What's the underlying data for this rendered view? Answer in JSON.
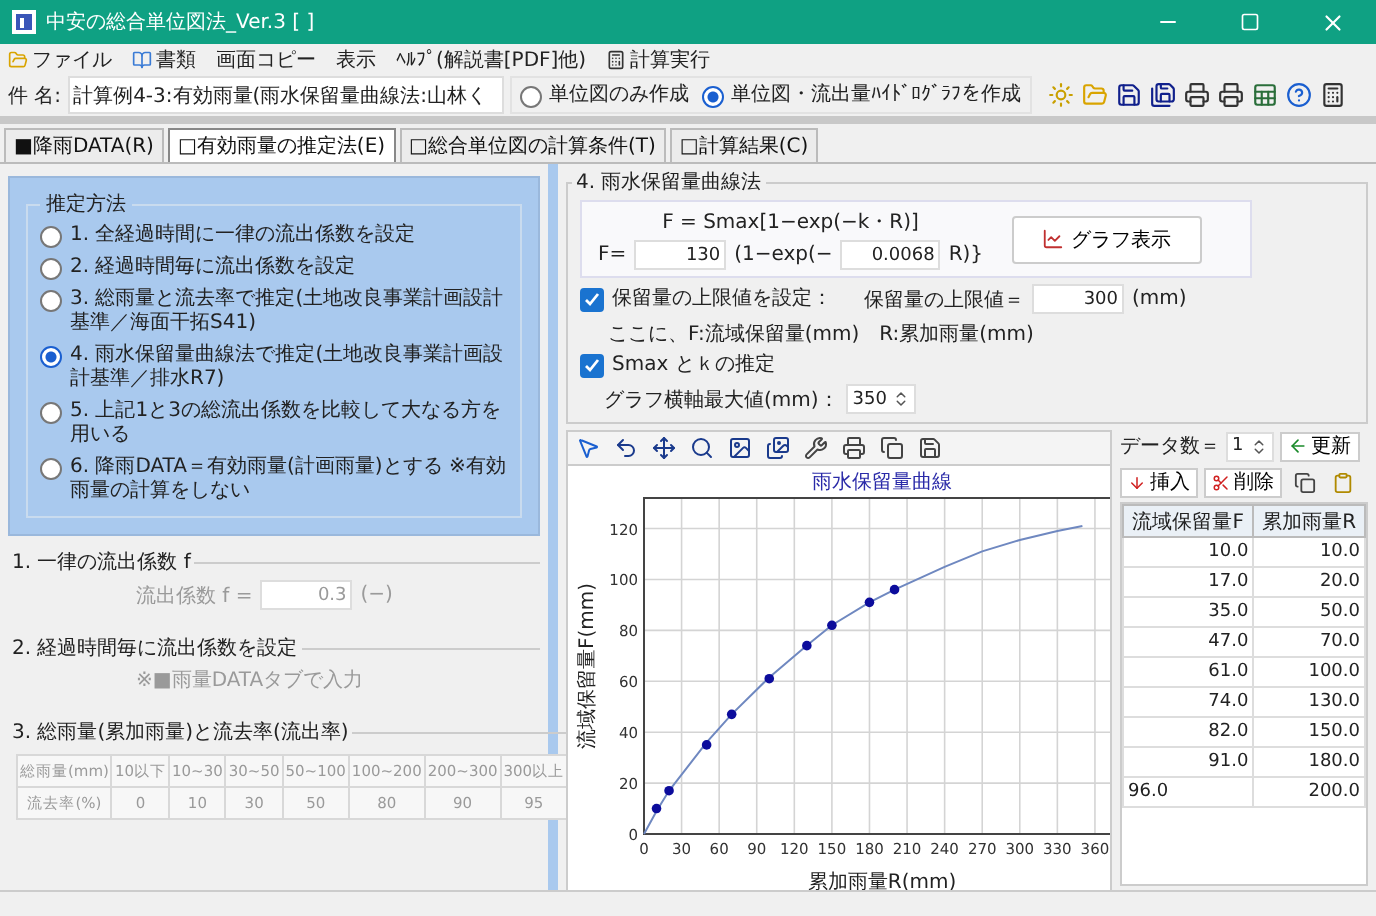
{
  "window": {
    "title": "中安の総合単位図法_Ver.3 [ ]"
  },
  "menu": [
    "ファイル",
    "書類",
    "画面コピー",
    "表示",
    "ﾍﾙﾌﾟ(解説書[PDF]他)",
    "計算実行"
  ],
  "subject": {
    "label": "件 名:",
    "value": "計算例4-3:有効雨量(雨水保留量曲線法:山林く"
  },
  "output_mode": [
    {
      "label": "単位図のみ作成",
      "selected": false
    },
    {
      "label": "単位図・流出量ﾊｲﾄﾞﾛｸﾞﾗﾌを作成",
      "selected": true
    }
  ],
  "tabs": [
    {
      "label": "■降雨DATA(R)",
      "selected": false
    },
    {
      "label": "□有効雨量の推定法(E)",
      "selected": true
    },
    {
      "label": "□総合単位図の計算条件(T)",
      "selected": false
    },
    {
      "label": "□計算結果(C)",
      "selected": false
    }
  ],
  "estimation": {
    "title": "推定方法",
    "options": [
      {
        "label": "1. 全経過時間に一律の流出係数を設定",
        "selected": false
      },
      {
        "label": "2. 経過時間毎に流出係数を設定",
        "selected": false
      },
      {
        "label": "3. 総雨量と流去率で推定(土地改良事業計画設計基準／海面干拓S41)",
        "selected": false
      },
      {
        "label": "4. 雨水保留量曲線法で推定(土地改良事業計画設計基準／排水R7)",
        "selected": true
      },
      {
        "label": "5. 上記1と3の総流出係数を比較して大なる方を用いる",
        "selected": false
      },
      {
        "label": "6. 降雨DATA＝有効雨量(計画雨量)とする ※有効雨量の計算をしない",
        "selected": false
      }
    ]
  },
  "constant_coefficient": {
    "title": "1. 一律の流出係数 f",
    "label": "流出係数 f =",
    "value": "0.3",
    "unit": "(−)",
    "disabled": true
  },
  "timestep_coefficient": {
    "title": "2. 経過時間毎に流出係数を設定",
    "note": "※■雨量DATAタブで入力",
    "disabled": true
  },
  "runoff_table": {
    "title": "3. 総雨量(累加雨量)と流去率(流出率)",
    "disabled": true,
    "rows": [
      [
        "総雨量(mm)",
        "10以下",
        "10~30",
        "30~50",
        "50~100",
        "100~200",
        "200~300",
        "300以上"
      ],
      [
        "流去率(%)",
        "0",
        "10",
        "30",
        "50",
        "80",
        "90",
        "95"
      ]
    ]
  },
  "retention_curve": {
    "title": "4. 雨水保留量曲線法",
    "formula": "F = Smax[1−exp(−k・R)]",
    "f_label": "F=",
    "smax": "130",
    "exp_label": "(1−exp(−",
    "k": "0.0068",
    "r_label": "R)}",
    "graph_button": "グラフ表示",
    "upper_limit": {
      "label": "保留量の上限値を設定：",
      "checked": true,
      "value_label": "保留量の上限値＝",
      "value": "300",
      "unit": "(mm)"
    },
    "legend": "ここに、F:流域保留量(mm)　R:累加雨量(mm)",
    "estimate": {
      "label": "Smax とｋの推定",
      "checked": true
    },
    "axis_max": {
      "label": "グラフ横軸最大値(mm)：",
      "value": "350"
    },
    "chart_data": {
      "type": "line",
      "title": "雨水保留量曲線",
      "xlabel": "累加雨量R(mm)",
      "ylabel": "流域保留量F(mm)",
      "x": [
        0,
        10,
        20,
        50,
        70,
        100,
        130,
        150,
        180,
        200,
        240,
        270,
        300,
        330,
        350
      ],
      "series": [
        {
          "color": "#6f88c0",
          "type": "line",
          "values": [
            0,
            9,
            17,
            36,
            47,
            61.5,
            74,
            82,
            91,
            96,
            105,
            111,
            115.5,
            119,
            121
          ]
        },
        {
          "color": "#0c0c9c",
          "type": "scatter",
          "values": [
            null,
            10,
            17,
            35,
            47,
            61,
            74,
            82,
            91,
            96,
            null,
            null,
            null,
            null,
            null
          ]
        }
      ],
      "xlim": [
        0,
        380
      ],
      "ylim": [
        0,
        132
      ],
      "xticks": [
        0,
        30,
        60,
        90,
        120,
        150,
        180,
        210,
        240,
        270,
        300,
        330,
        360
      ],
      "yticks": [
        0,
        20,
        40,
        60,
        80,
        100,
        120
      ],
      "grid": true
    }
  },
  "data_panel": {
    "count_label": "データ数＝",
    "count": "1",
    "update": "更新",
    "insert": "挿入",
    "delete": "削除",
    "columns": [
      "流域保留量F",
      "累加雨量R"
    ],
    "rows": [
      {
        "cells": [
          "10.0",
          "10.0"
        ],
        "editing": false
      },
      {
        "cells": [
          "17.0",
          "20.0"
        ],
        "editing": false
      },
      {
        "cells": [
          "35.0",
          "50.0"
        ],
        "editing": false
      },
      {
        "cells": [
          "47.0",
          "70.0"
        ],
        "editing": false
      },
      {
        "cells": [
          "61.0",
          "100.0"
        ],
        "editing": false
      },
      {
        "cells": [
          "74.0",
          "130.0"
        ],
        "editing": false
      },
      {
        "cells": [
          "82.0",
          "150.0"
        ],
        "editing": false
      },
      {
        "cells": [
          "91.0",
          "180.0"
        ],
        "editing": false
      },
      {
        "cells": [
          "96.0",
          "200.0"
        ],
        "editing": true
      }
    ]
  }
}
